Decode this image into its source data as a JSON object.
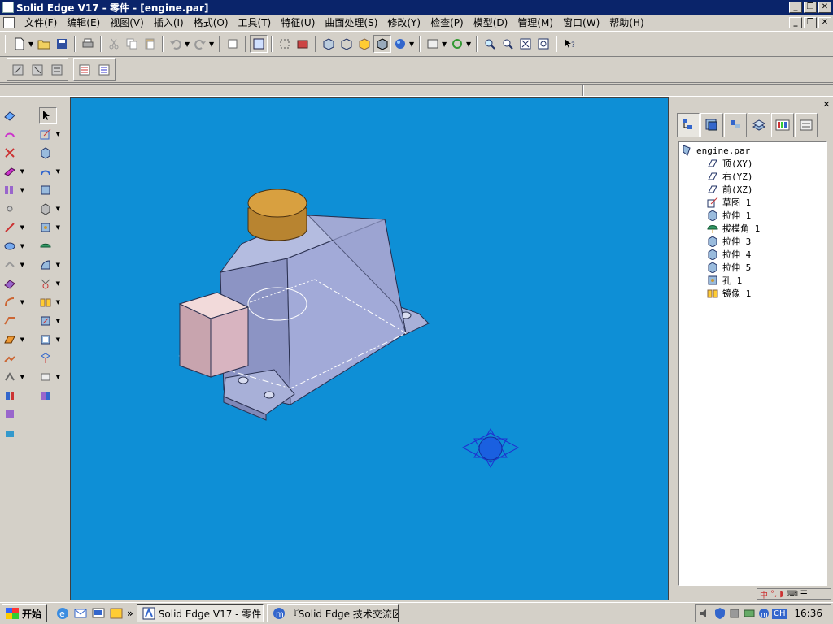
{
  "window": {
    "title": "Solid Edge V17 - 零件 - [engine.par]"
  },
  "window_buttons": {
    "minimize": "_",
    "restore": "❐",
    "close": "✕"
  },
  "menu": [
    {
      "label": "文件(F)"
    },
    {
      "label": "编辑(E)"
    },
    {
      "label": "视图(V)"
    },
    {
      "label": "插入(I)"
    },
    {
      "label": "格式(O)"
    },
    {
      "label": "工具(T)"
    },
    {
      "label": "特征(U)"
    },
    {
      "label": "曲面处理(S)"
    },
    {
      "label": "修改(Y)"
    },
    {
      "label": "检查(P)"
    },
    {
      "label": "模型(D)"
    },
    {
      "label": "管理(M)"
    },
    {
      "label": "窗口(W)"
    },
    {
      "label": "帮助(H)"
    }
  ],
  "colors": {
    "viewport": "#0e8fd6",
    "titlebar": "#0a246a",
    "part_body": "#a8b0d8",
    "cylinder": "#c8963c",
    "block": "#e8c8c8"
  },
  "pathfinder": {
    "root": "engine.par",
    "items": [
      {
        "label": "顶(XY)",
        "icon": "plane-icon"
      },
      {
        "label": "右(YZ)",
        "icon": "plane-icon"
      },
      {
        "label": "前(XZ)",
        "icon": "plane-icon"
      },
      {
        "label": "草图 1",
        "icon": "sketch-icon"
      },
      {
        "label": "拉伸 1",
        "icon": "extrude-icon"
      },
      {
        "label": "拔模角 1",
        "icon": "draft-icon"
      },
      {
        "label": "拉伸 3",
        "icon": "extrude-icon"
      },
      {
        "label": "拉伸 4",
        "icon": "extrude-icon"
      },
      {
        "label": "拉伸 5",
        "icon": "extrude-icon"
      },
      {
        "label": "孔 1",
        "icon": "hole-icon"
      },
      {
        "label": "镜像 1",
        "icon": "mirror-icon"
      }
    ]
  },
  "taskbar": {
    "start_label": "开始",
    "more_label": "»",
    "tasks": [
      {
        "label": "Solid Edge V17 - 零件 - [e...",
        "active": true
      },
      {
        "label": "『Solid Edge 技术交流区...",
        "active": false
      }
    ],
    "ime_label": "CH",
    "clock": "16:36"
  }
}
